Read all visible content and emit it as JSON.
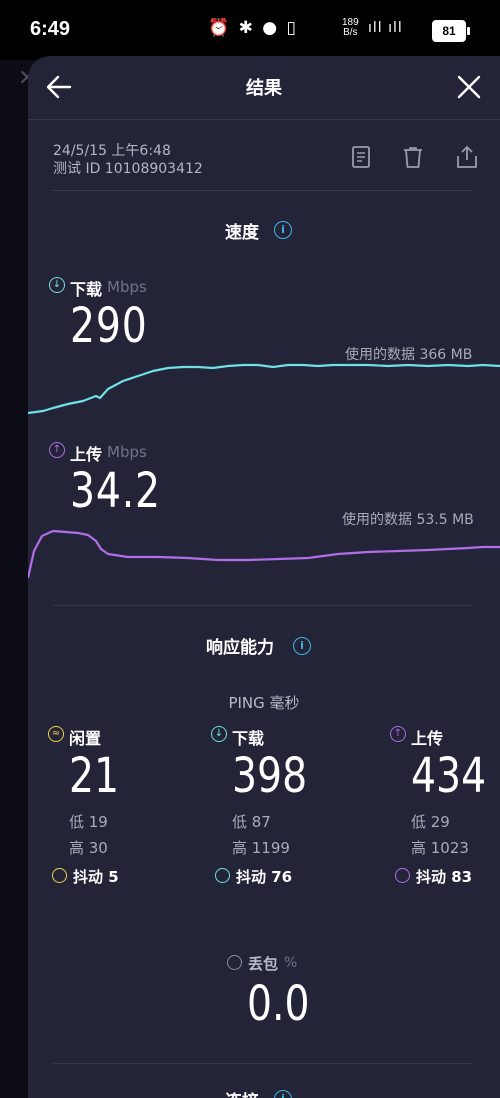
{
  "status_bar": {
    "time": "6:49",
    "icons": "⏰ ✱ ● ▯",
    "net_speed_value": "189",
    "net_speed_unit": "B/s",
    "signal": "ıll ıll",
    "battery": "81"
  },
  "header": {
    "title": "结果",
    "back_icon": "arrow-left-icon",
    "close_icon": "close-icon"
  },
  "test_meta": {
    "date": "24/5/15 上午6:48",
    "test_id": "测试 ID 10108903412"
  },
  "speed": {
    "section_title": "速度",
    "download": {
      "label": "下载",
      "unit": "Mbps",
      "value": "290",
      "data_used": "使用的数据 366 MB",
      "color": "#6fe0e6"
    },
    "upload": {
      "label": "上传",
      "unit": "Mbps",
      "value": "34.2",
      "data_used": "使用的数据 53.5 MB",
      "color": "#b06ee8"
    }
  },
  "responsiveness": {
    "section_title": "响应能力",
    "ping_title": "PING 毫秒",
    "idle": {
      "label": "闲置",
      "value": "21",
      "low": "低 19",
      "high": "高 30",
      "jitter": "抖动 5",
      "color": "#f0d24a"
    },
    "download": {
      "label": "下载",
      "value": "398",
      "low": "低 87",
      "high": "高 1199",
      "jitter": "抖动 76",
      "color": "#6fe0e6"
    },
    "upload": {
      "label": "上传",
      "value": "434",
      "low": "低 29",
      "high": "高 1023",
      "jitter": "抖动 83",
      "color": "#b06ee8"
    }
  },
  "packet_loss": {
    "label": "丢包",
    "unit": "%",
    "value": "0.0"
  },
  "next_section_partial": "连接"
}
